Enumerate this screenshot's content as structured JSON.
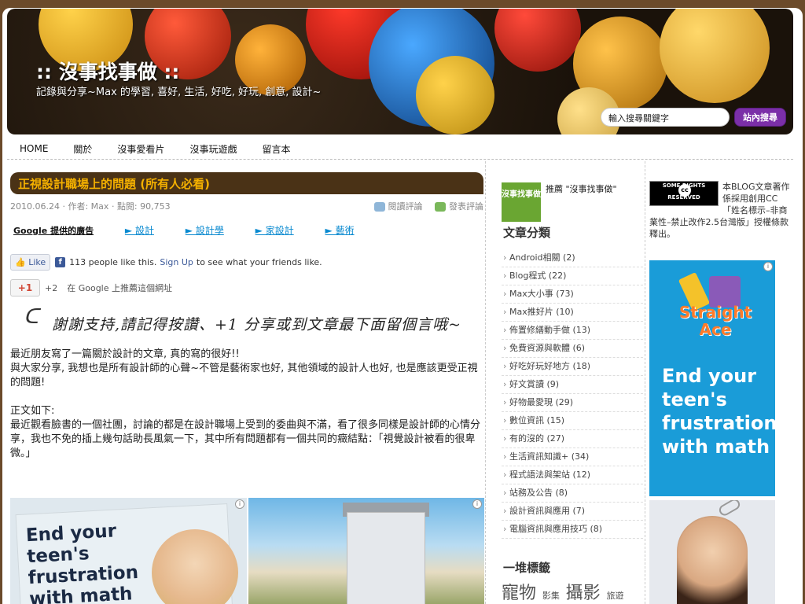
{
  "header": {
    "site_title": ":: 沒事找事做 ::",
    "site_subtitle": "記錄與分享~Max 的學習, 喜好, 生活, 好吃, 好玩, 創意, 設計~",
    "search_value": "輸入搜尋關鍵字",
    "search_button": "站內搜尋"
  },
  "nav": [
    "HOME",
    "關於",
    "沒事愛看片",
    "沒事玩遊戲",
    "留言本"
  ],
  "post": {
    "title": "正視設計職場上的問題 (所有人必看)",
    "date": "2010.06.24",
    "author": "作者: Max",
    "views": "點閱: 90,753",
    "read_comments": "閱讀評論",
    "post_comment": "發表評論"
  },
  "ad_links": {
    "label": "Google 提供的廣告",
    "links": [
      "► 設計",
      "► 設計學",
      "► 家設計",
      "► 藝術"
    ]
  },
  "facebook": {
    "like_label": "Like",
    "count_text": "113 people like this.",
    "signup": "Sign Up",
    "rest": "to see what your friends like."
  },
  "gplus": {
    "button": "+1",
    "count": "+2",
    "text": "在 Google 上推薦這個網址"
  },
  "handwritten_note": "謝謝支持,請記得按讚、+1 分享或到文章最下面留個言哦~",
  "body": {
    "p1": "最近朋友寫了一篇關於設計的文章, 真的寫的很好!!",
    "p2": "與大家分享, 我想也是所有設計師的心聲~不管是藝術家也好, 其他領域的設計人也好, 也是應該更受正視的問題!",
    "p3": "正文如下:",
    "p4": "最近觀看臉書的一個社團，討論的都是在設計職場上受到的委曲與不滿，看了很多同樣是設計師的心情分享，我也不免的插上幾句話助長風氣一下，其中所有問題都有一個共同的癥結點：「視覺設計被看的很卑微。」"
  },
  "content_ads": {
    "left_text": "End your teen's frustration with math",
    "info_icon": "i"
  },
  "sidebar": {
    "recommend_text": "推薦 \"沒事找事做\"",
    "recommend_logo": "沒事找事做",
    "categories_title": "文章分類",
    "categories": [
      "Android相關 (2)",
      "Blog程式 (22)",
      "Max大小事 (73)",
      "Max推好片 (10)",
      "佈置修繕動手做 (13)",
      "免費資源與軟體 (6)",
      "好吃好玩好地方 (18)",
      "好文賞讀 (9)",
      "好物最愛現 (29)",
      "數位資訊 (15)",
      "有的沒的 (27)",
      "生活資訊知識+ (34)",
      "程式語法與架站 (12)",
      "站務及公告 (8)",
      "設計資訊與應用 (7)",
      "電腦資訊與應用技巧 (8)"
    ],
    "tags_title": "一堆標籤",
    "tags": [
      "寵物",
      "影集",
      "攝影",
      "旅遊"
    ]
  },
  "right_sidebar": {
    "cc_badge_text": "SOME RIGHTS RESERVED",
    "cc_logo": "cc",
    "cc_text": "本BLOG文章著作係採用創用CC「姓名標示–非商業性–禁止改作2.5台灣版」授權條款釋出。",
    "ad_brand": "Straight Ace",
    "ad_message": "End your teen's frustration with math"
  }
}
